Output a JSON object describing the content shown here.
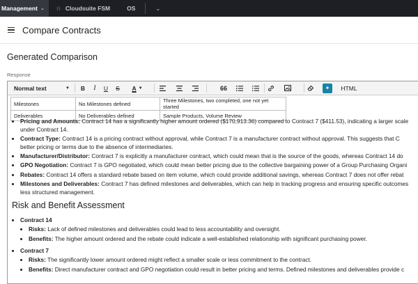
{
  "topnav": {
    "active_tab": "Management",
    "item1": "Cloudsuite FSM",
    "item2": "OS"
  },
  "header": {
    "title": "Compare Contracts"
  },
  "section": {
    "title": "Generated Comparison",
    "response_label": "Response"
  },
  "toolbar": {
    "format": "Normal text",
    "bold": "B",
    "italic": "I",
    "underline": "U",
    "strike": "S",
    "color": "A",
    "quote": "66",
    "html": "HTML"
  },
  "table": [
    [
      "Milestones",
      "No Milestones defined",
      "Three Milestones, two completed, one not yet started"
    ],
    [
      "Deliverables",
      "No Deliverables defined",
      "Sample Products, Volume Review"
    ]
  ],
  "bullets": [
    {
      "label": "Pricing and Amounts:",
      "text": " Contract 14 has a significantly higher amount ordered ($170,913.36) compared to Contract 7 ($411.53), indicating a larger scale"
    },
    {
      "label": "",
      "text": "under Contract 14."
    },
    {
      "label": "Contract Type:",
      "text": " Contract 14 is a pricing contract without approval, while Contract 7 is a manufacturer contract without approval. This suggests that C"
    },
    {
      "label": "",
      "text": "better pricing or terms due to the absence of intermediaries."
    },
    {
      "label": "Manufacturer/Distributor:",
      "text": " Contract 7 is explicitly a manufacturer contract, which could mean that is the source of the goods, whereas Contract 14 do"
    },
    {
      "label": "GPO Negotiation:",
      "text": " Contract 7 is GPO negotiated, which could mean better pricing due to the collective bargaining power of a Group Purchasing Organi"
    },
    {
      "label": "Rebates:",
      "text": " Contract 14 offers a standard rebate based on item volume, which could provide additional savings, whereas Contract 7 does not offer rebat"
    },
    {
      "label": "Milestones and Deliverables:",
      "text": " Contract 7 has defined milestones and deliverables, which can help in tracking progress and ensuring specific outcomes"
    },
    {
      "label": "",
      "text": "less structured management."
    }
  ],
  "risk": {
    "heading": "Risk and Benefit Assessment",
    "c14": {
      "title": "Contract 14",
      "risks_label": "Risks:",
      "risks_text": " Lack of defined milestones and deliverables could lead to less accountability and oversight.",
      "benefits_label": "Benefits:",
      "benefits_text": " The higher amount ordered and the rebate could indicate a well-established relationship with significant purchasing power."
    },
    "c7": {
      "title": "Contract 7",
      "risks_label": "Risks:",
      "risks_text": " The significantly lower amount ordered might reflect a smaller scale or less commitment to the contract.",
      "benefits_label": "Benefits:",
      "benefits_text": " Direct manufacturer contract and GPO negotiation could result in better pricing and terms. Defined milestones and deliverables provide c"
    }
  }
}
